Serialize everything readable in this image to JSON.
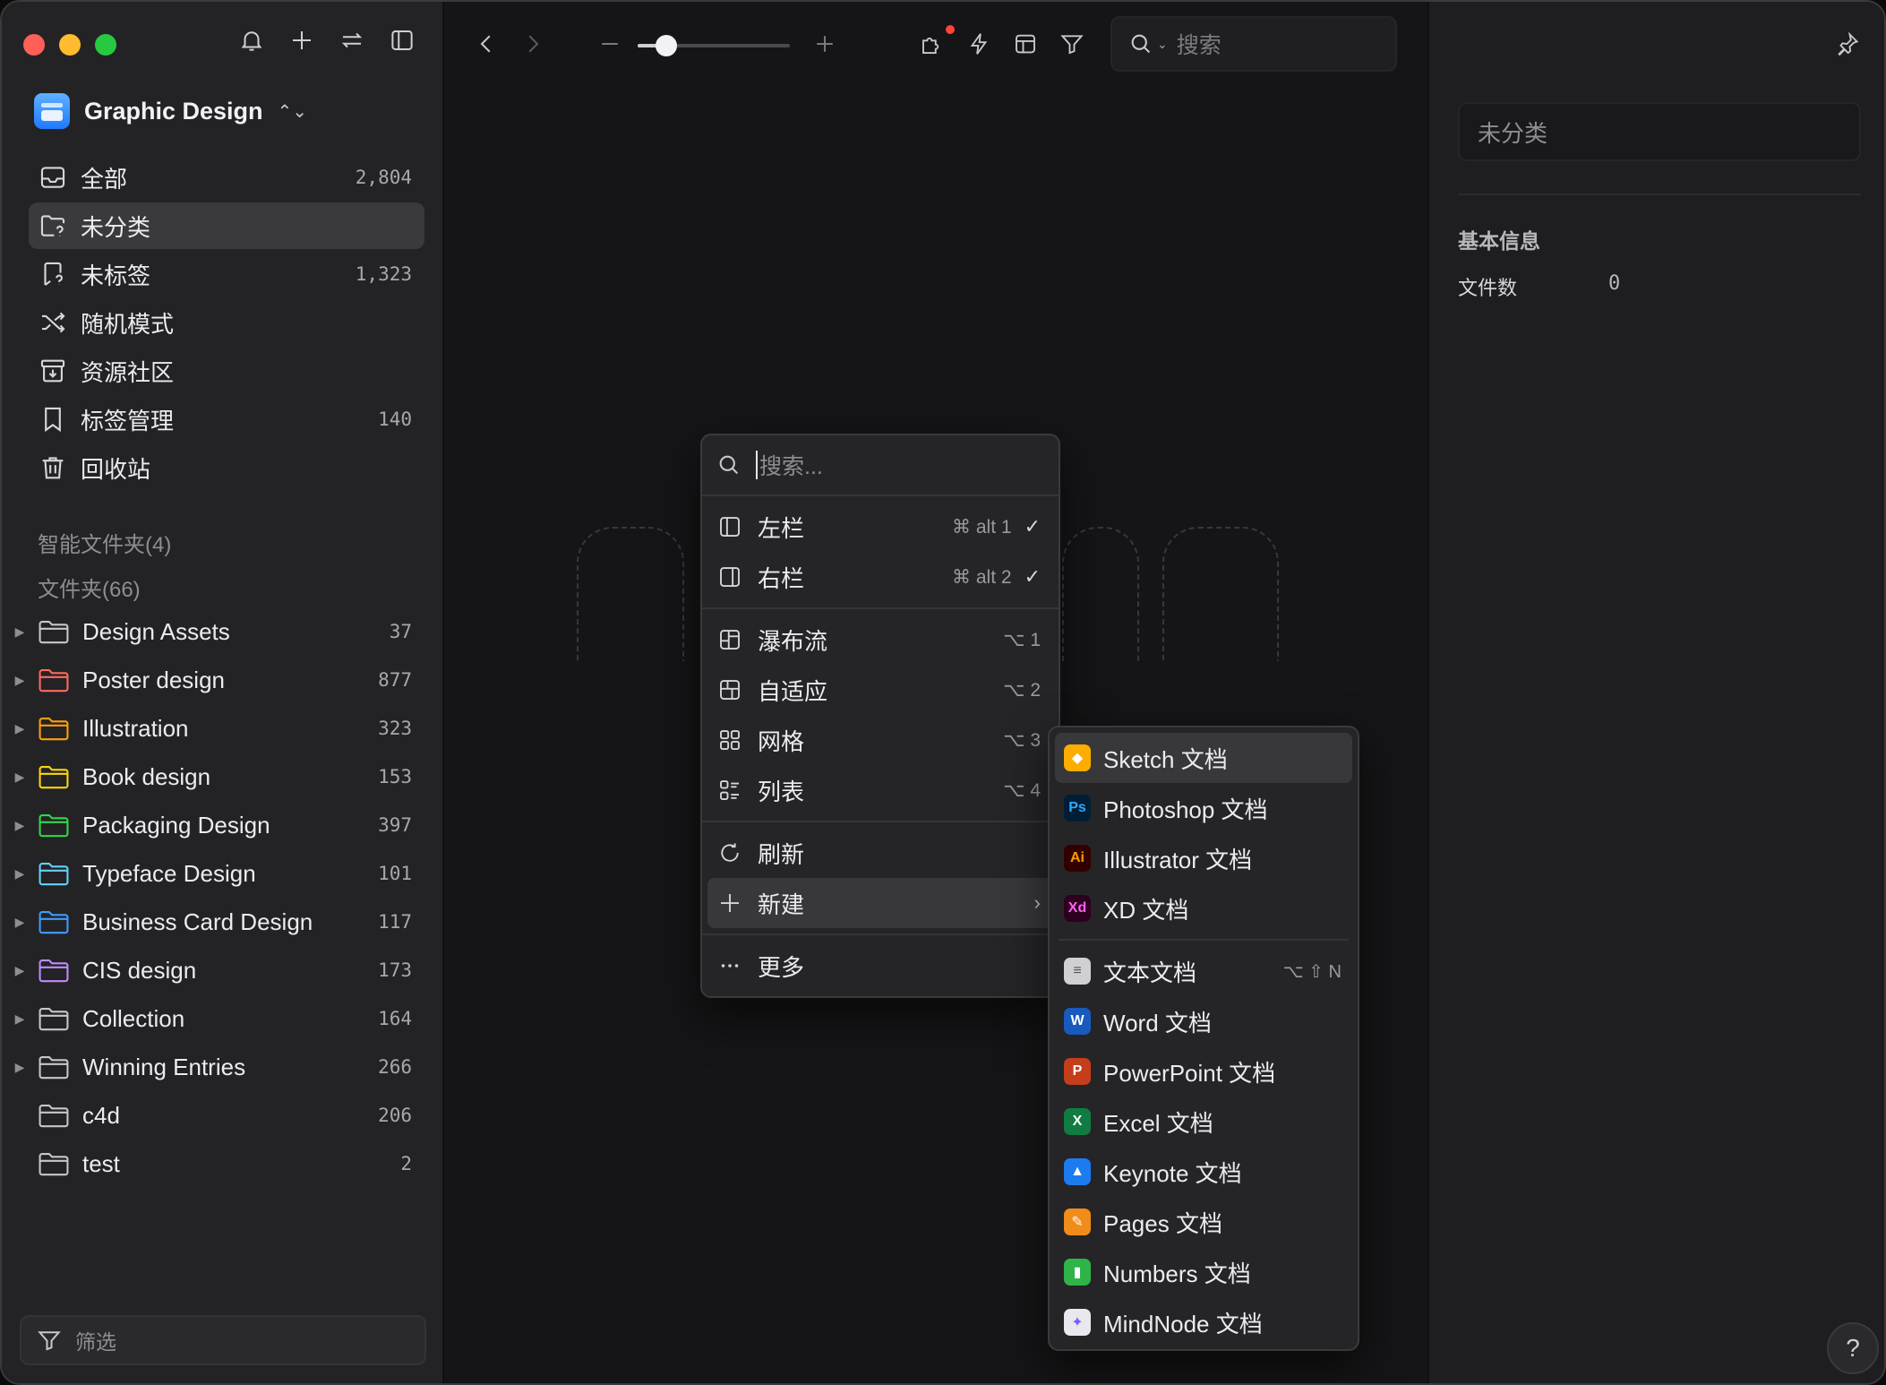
{
  "sidebar": {
    "library_name": "Graphic Design",
    "nav": [
      {
        "label": "全部",
        "count": "2,804",
        "icon": "inbox-icon"
      },
      {
        "label": "未分类",
        "count": "",
        "icon": "unsorted-folder-icon"
      },
      {
        "label": "未标签",
        "count": "1,323",
        "icon": "untagged-icon"
      },
      {
        "label": "随机模式",
        "count": "",
        "icon": "shuffle-icon"
      },
      {
        "label": "资源社区",
        "count": "",
        "icon": "community-icon"
      },
      {
        "label": "标签管理",
        "count": "140",
        "icon": "bookmark-icon"
      },
      {
        "label": "回收站",
        "count": "",
        "icon": "trash-icon"
      }
    ],
    "smart_folders_title": "智能文件夹(4)",
    "folders_title": "文件夹(66)",
    "folders": [
      {
        "label": "Design Assets",
        "count": "37",
        "color": "#c8c8ca",
        "expandable": true
      },
      {
        "label": "Poster design",
        "count": "877",
        "color": "#ff6961",
        "expandable": true
      },
      {
        "label": "Illustration",
        "count": "323",
        "color": "#ff9f0a",
        "expandable": true
      },
      {
        "label": "Book design",
        "count": "153",
        "color": "#ffd60a",
        "expandable": true
      },
      {
        "label": "Packaging Design",
        "count": "397",
        "color": "#32d74b",
        "expandable": true
      },
      {
        "label": "Typeface Design",
        "count": "101",
        "color": "#64d2ff",
        "expandable": true
      },
      {
        "label": "Business Card Design",
        "count": "117",
        "color": "#409cff",
        "expandable": true
      },
      {
        "label": "CIS design",
        "count": "173",
        "color": "#bf8cff",
        "expandable": true
      },
      {
        "label": "Collection",
        "count": "164",
        "color": "#c8c8ca",
        "expandable": true
      },
      {
        "label": "Winning Entries",
        "count": "266",
        "color": "#c8c8ca",
        "expandable": true
      },
      {
        "label": "c4d",
        "count": "206",
        "color": "#c8c8ca",
        "expandable": false
      },
      {
        "label": "test",
        "count": "2",
        "color": "#c8c8ca",
        "expandable": false
      }
    ],
    "filter_placeholder": "筛选"
  },
  "toolbar": {
    "search_placeholder": "搜索"
  },
  "right_panel": {
    "category": "未分类",
    "section_title": "基本信息",
    "file_count_label": "文件数",
    "file_count_value": "0",
    "help": "?"
  },
  "context_menu": {
    "search_placeholder": "搜索...",
    "items": {
      "left_panel": {
        "label": "左栏",
        "shortcut": "⌘ alt 1"
      },
      "right_panel": {
        "label": "右栏",
        "shortcut": "⌘ alt 2"
      },
      "waterfall": {
        "label": "瀑布流",
        "shortcut": "⌥ 1"
      },
      "adaptive": {
        "label": "自适应",
        "shortcut": "⌥ 2"
      },
      "grid": {
        "label": "网格",
        "shortcut": "⌥ 3"
      },
      "list": {
        "label": "列表",
        "shortcut": "⌥ 4"
      },
      "refresh": {
        "label": "刷新"
      },
      "new": {
        "label": "新建"
      },
      "more": {
        "label": "更多"
      }
    }
  },
  "submenu": {
    "items": [
      {
        "label": "Sketch 文档",
        "icon": "sketch-icon"
      },
      {
        "label": "Photoshop 文档",
        "icon": "photoshop-icon"
      },
      {
        "label": "Illustrator 文档",
        "icon": "illustrator-icon"
      },
      {
        "label": "XD 文档",
        "icon": "xd-icon"
      },
      {
        "label": "文本文档",
        "icon": "text-doc-icon",
        "shortcut": "⌥ ⇧ N"
      },
      {
        "label": "Word 文档",
        "icon": "word-icon"
      },
      {
        "label": "PowerPoint 文档",
        "icon": "powerpoint-icon"
      },
      {
        "label": "Excel 文档",
        "icon": "excel-icon"
      },
      {
        "label": "Keynote 文档",
        "icon": "keynote-icon"
      },
      {
        "label": "Pages 文档",
        "icon": "pages-icon"
      },
      {
        "label": "Numbers 文档",
        "icon": "numbers-icon"
      },
      {
        "label": "MindNode 文档",
        "icon": "mindnode-icon"
      }
    ]
  }
}
